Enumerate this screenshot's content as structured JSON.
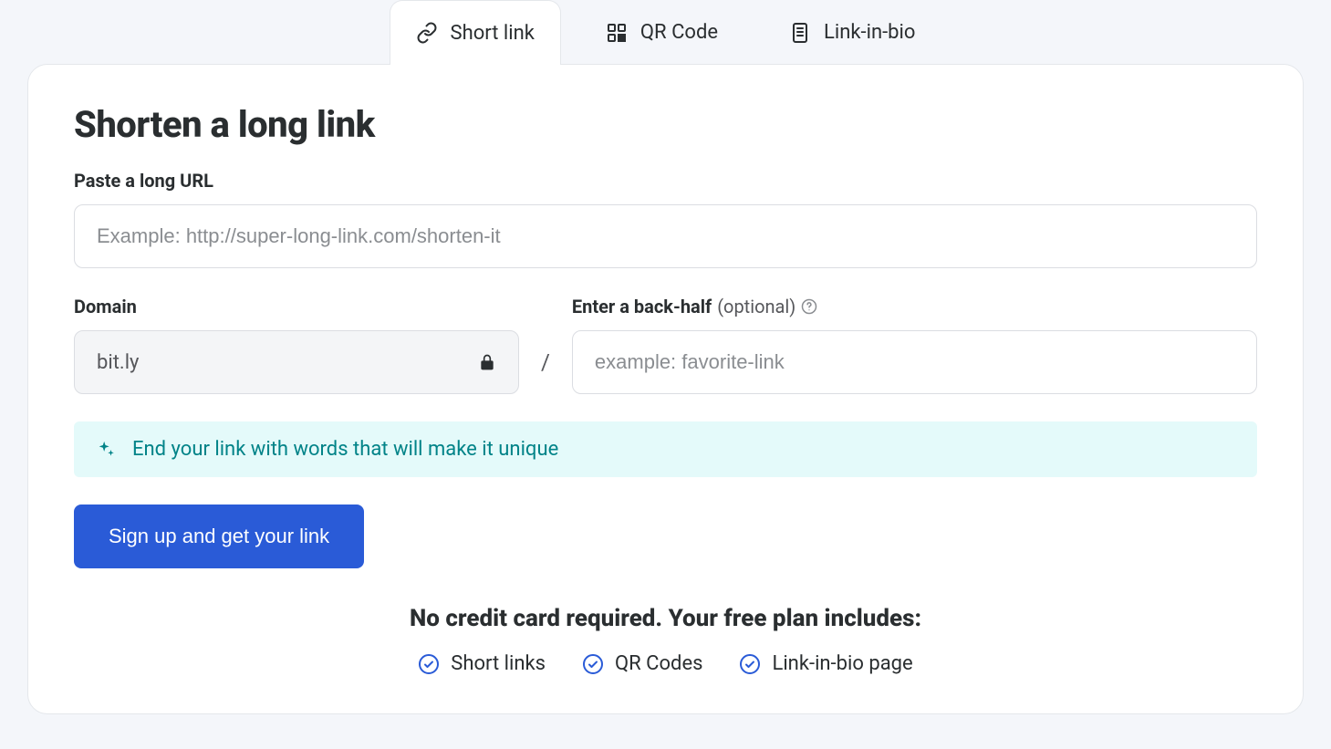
{
  "tabs": [
    {
      "label": "Short link",
      "icon": "link-icon"
    },
    {
      "label": "QR Code",
      "icon": "qr-icon"
    },
    {
      "label": "Link-in-bio",
      "icon": "page-icon"
    }
  ],
  "heading": "Shorten a long link",
  "url_field": {
    "label": "Paste a long URL",
    "placeholder": "Example: http://super-long-link.com/shorten-it",
    "value": ""
  },
  "domain_field": {
    "label": "Domain",
    "value": "bit.ly"
  },
  "backhalf_field": {
    "label": "Enter a back-half",
    "optional_label": "(optional)",
    "placeholder": "example: favorite-link",
    "value": ""
  },
  "separator": "/",
  "tip": "End your link with words that will make it unique",
  "cta_label": "Sign up and get your link",
  "footer_heading": "No credit card required. Your free plan includes:",
  "features": [
    "Short links",
    "QR Codes",
    "Link-in-bio page"
  ],
  "colors": {
    "accent": "#2a5bd7",
    "teal": "#018388",
    "tip_bg": "#e4fafa",
    "page_bg": "#f4f6fa"
  }
}
